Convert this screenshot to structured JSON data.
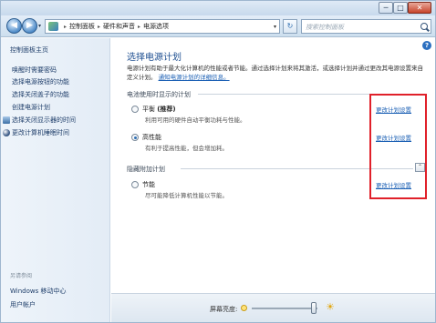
{
  "window": {
    "controls": {
      "minimize": "─",
      "maximize": "□",
      "close": "✕"
    }
  },
  "nav": {
    "back_icon": "◀",
    "forward_icon": "▶",
    "dropdown_icon": "▾",
    "breadcrumbs": [
      "控制面板",
      "硬件和声音",
      "电源选项"
    ],
    "separator": "▸",
    "address_dropdown": "▾",
    "refresh_icon": "↻",
    "search_placeholder": "搜索控制面板"
  },
  "sidebar": {
    "home": "控制面板主页",
    "items": [
      {
        "label": "唤醒时需要密码",
        "icon": ""
      },
      {
        "label": "选择电源按钮的功能",
        "icon": ""
      },
      {
        "label": "选择关闭盖子的功能",
        "icon": ""
      },
      {
        "label": "创建电源计划",
        "icon": ""
      },
      {
        "label": "选择关闭显示器的时间",
        "icon": "monitor-icon"
      },
      {
        "label": "更改计算机睡眠时间",
        "icon": "moon-icon"
      }
    ],
    "see_also": "另请参阅",
    "bottom_links": [
      "Windows 移动中心",
      "用户帐户"
    ]
  },
  "main": {
    "help_icon": "?",
    "title": "选择电源计划",
    "description": "电源计划有助于最大化计算机的性能或者节能。通过选择计划来将其激活，或选择计划并通过更改其电源设置来自定义计划。",
    "description_link": "通知电源计划的详细信息。",
    "section_shown": "电池使用时显示的计划",
    "section_hidden": "隐藏附加计划",
    "collapse_icon": "⌃",
    "plans": [
      {
        "name": "平衡",
        "tag": "(推荐)",
        "desc": "利用可用的硬件自动平衡功耗与性能。",
        "checked": false,
        "change": "更改计划设置"
      },
      {
        "name": "高性能",
        "tag": "",
        "desc": "有利于提高性能，但会增加耗。",
        "checked": true,
        "change": "更改计划设置"
      },
      {
        "name": "节能",
        "tag": "",
        "desc": "尽可能降低计算机性能以节能。",
        "checked": false,
        "change": "更改计划设置"
      }
    ]
  },
  "status": {
    "brightness_label": "屏幕亮度:",
    "brightness_level": 0.95,
    "sun_big": "☀"
  },
  "colors": {
    "highlight_box": "#e0202a",
    "link": "#1a5fb4",
    "title": "#1e4f91"
  }
}
